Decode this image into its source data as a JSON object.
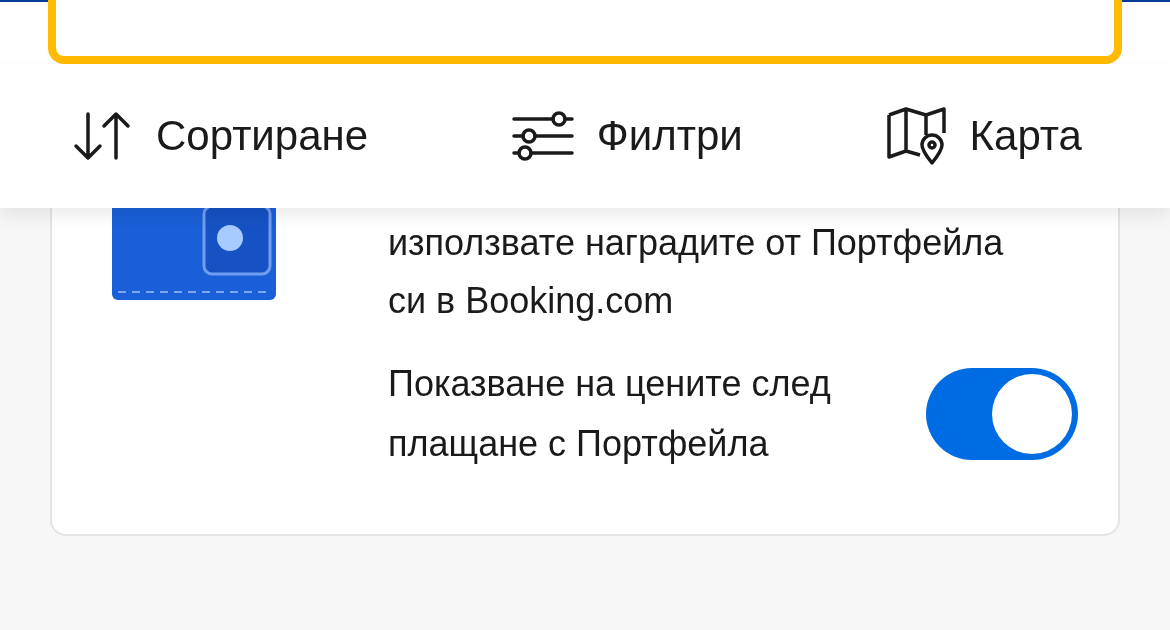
{
  "toolbar": [
    {
      "kind": "sort",
      "label": "Сортиране"
    },
    {
      "kind": "filter",
      "label": "Филтри"
    },
    {
      "kind": "map",
      "label": "Карта"
    }
  ],
  "wallet_card": {
    "description": "използвате наградите от Портфейла си в Booking.com",
    "toggle": {
      "label": "Показване на цените след плащане с Портфейла",
      "on": true
    }
  }
}
